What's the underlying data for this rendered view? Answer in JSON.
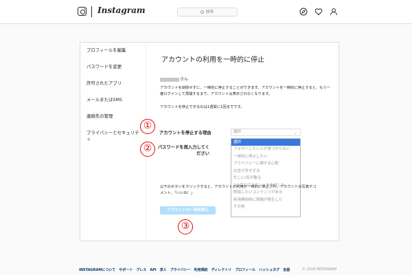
{
  "header": {
    "wordmark": "Instagram",
    "search_placeholder": "検索"
  },
  "sidebar": {
    "items": [
      {
        "label": "プロフィールを編集"
      },
      {
        "label": "パスワードを変更"
      },
      {
        "label": "許可されたアプリ"
      },
      {
        "label": "メールまたはSMS"
      },
      {
        "label": "連絡先の管理"
      },
      {
        "label": "プライバシーとセキュリティ"
      }
    ]
  },
  "main": {
    "title": "アカウントの利用を一時的に停止",
    "username_suffix": "さん",
    "description": "アカウントを削除せずに、一時的に停止することができます。アカウントを一時的に停止すると、もう一度ログインして再開するまで、アカウントは表示されなくなります。",
    "note": "アカウントを停止できるのは1週間に1回までです。",
    "reason_label": "アカウントを停止する理由",
    "password_label": "パスワードを再入力してください",
    "select_value": "選択",
    "options": [
      "選択",
      "フォローしたい人が見つからない",
      "一時的に停止したい",
      "プライバシーに関する心配",
      "広告が多すぎる",
      "忙しい/気が散る",
      "2つ目のアカウントを作成した",
      "削除したいコンテンツがある",
      "利用開始時に問題が発生した",
      "その他"
    ],
    "bottom_text": "以下のボタンをクリックすると、アカウントの利用が一時的に停止され、アカウントの写真やコメント、「いいね！」",
    "button_label": "アカウントの一時的停止"
  },
  "annotations": [
    "①",
    "②",
    "③"
  ],
  "footer": {
    "links": [
      "INSTAGRAMについて",
      "サポート",
      "プレス",
      "API",
      "求人",
      "プライバシー",
      "利用規約",
      "ディレクトリ",
      "プロフィール",
      "ハッシュタグ",
      "言語"
    ],
    "copyright": "© 2018 INSTAGRAM"
  },
  "colors": {
    "accent": "#3879d9",
    "disabled_button": "#b2dffc",
    "annotation": "#e60000"
  }
}
